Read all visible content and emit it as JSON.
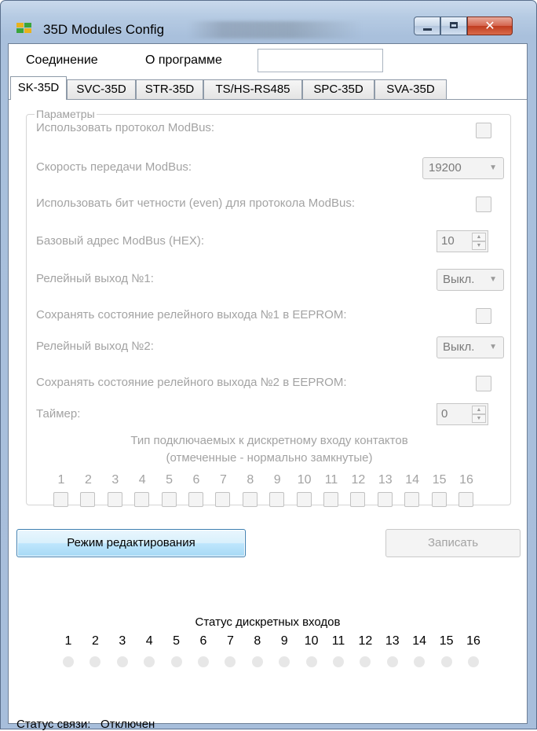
{
  "window": {
    "title": "35D Modules Config"
  },
  "menu": {
    "items": [
      "Соединение",
      "О программе"
    ]
  },
  "tabs": [
    "SK-35D",
    "SVC-35D",
    "STR-35D",
    "TS/HS-RS485",
    "SPC-35D",
    "SVA-35D"
  ],
  "active_tab": "SK-35D",
  "params": {
    "legend": "Параметры",
    "use_modbus": "Использовать протокол ModBus:",
    "modbus_speed": "Скорость передачи ModBus:",
    "modbus_speed_value": "19200",
    "parity": "Использовать бит четности (even) для протокола ModBus:",
    "base_address": "Базовый адрес ModBus (HEX):",
    "base_address_value": "10",
    "relay1": "Релейный выход №1:",
    "relay1_value": "Выкл.",
    "relay1_eeprom": "Сохранять состояние релейного выхода №1 в EEPROM:",
    "relay2": "Релейный выход №2:",
    "relay2_value": "Выкл.",
    "relay2_eeprom": "Сохранять состояние релейного выхода №2 в EEPROM:",
    "timer": "Таймер:",
    "timer_value": "0",
    "contacts_line1": "Тип подключаемых к дискретному входу контактов",
    "contacts_line2": "(отмеченные - нормально замкнутые)",
    "inputs": [
      "1",
      "2",
      "3",
      "4",
      "5",
      "6",
      "7",
      "8",
      "9",
      "10",
      "11",
      "12",
      "13",
      "14",
      "15",
      "16"
    ]
  },
  "buttons": {
    "edit_mode": "Режим редактирования",
    "write": "Записать"
  },
  "discrete_status": {
    "title": "Статус дискретных входов",
    "inputs": [
      "1",
      "2",
      "3",
      "4",
      "5",
      "6",
      "7",
      "8",
      "9",
      "10",
      "11",
      "12",
      "13",
      "14",
      "15",
      "16"
    ]
  },
  "connection": {
    "label": "Статус связи:",
    "value": "Отключен"
  },
  "colors": {
    "disabled_text": "#a3a3a3",
    "indicator_off": "#e7e7e7",
    "accent_button": "#3c7fb1"
  }
}
